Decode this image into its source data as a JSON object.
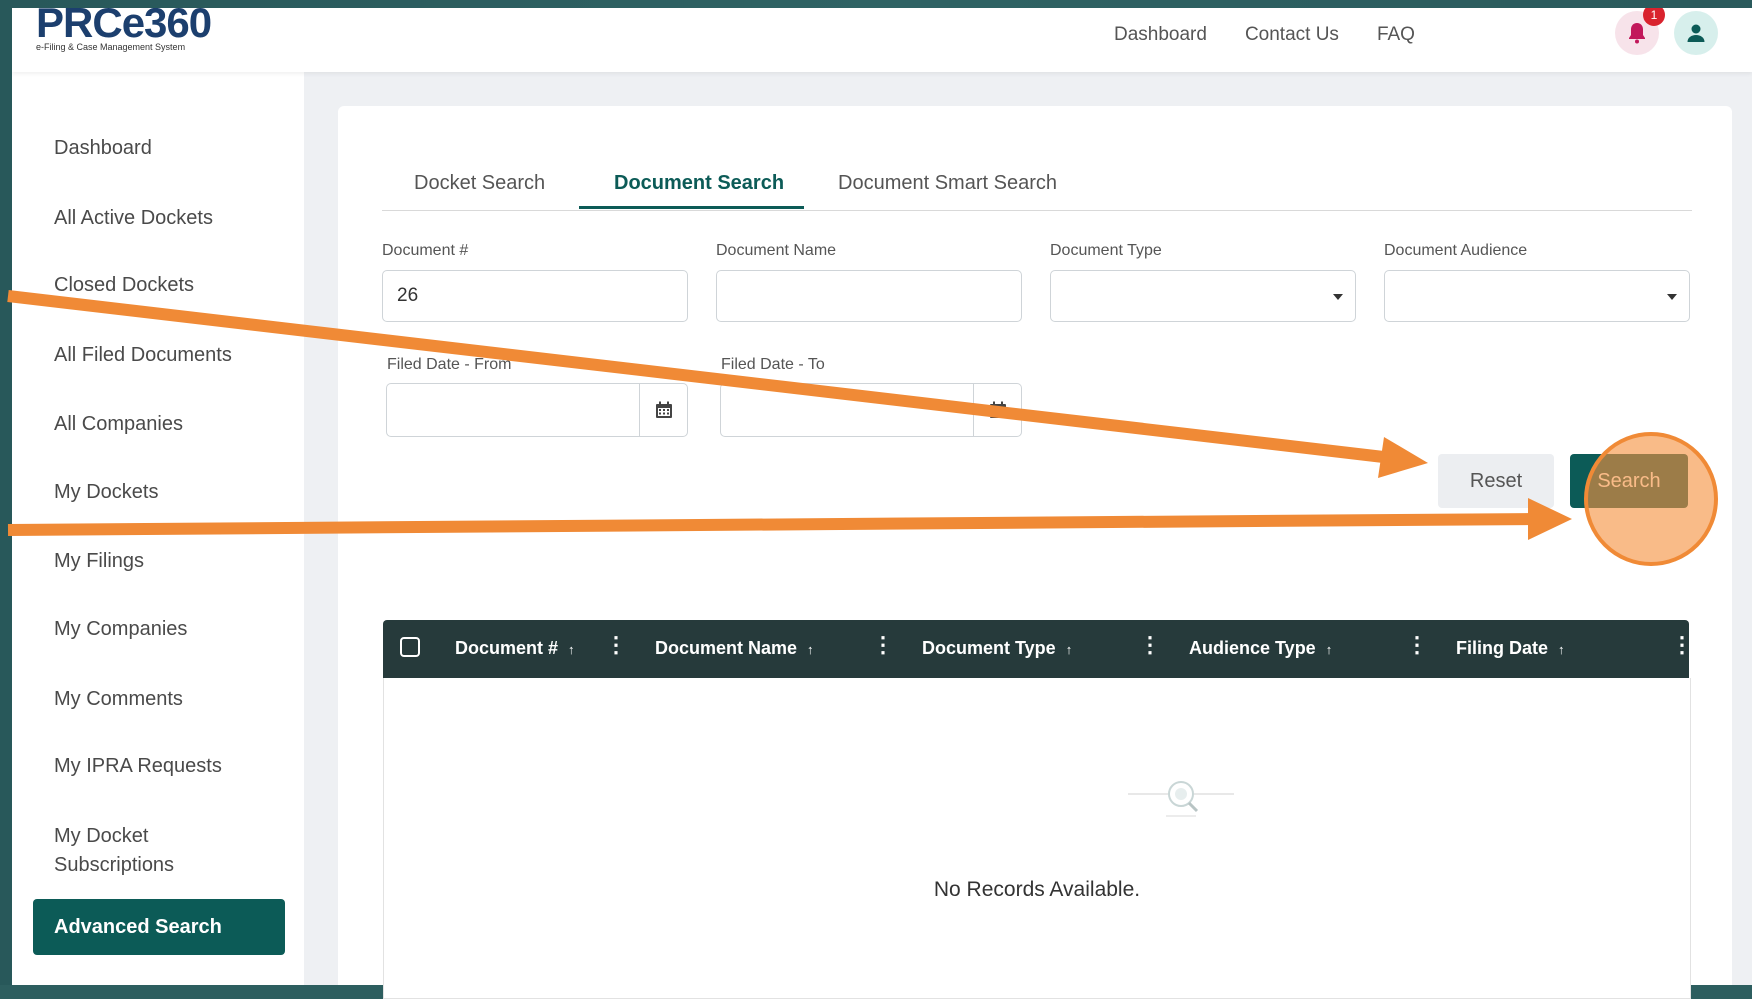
{
  "app": {
    "logo_text": "PRC",
    "logo_accent": "e360",
    "logo_tagline": "e-Filing & Case Management System"
  },
  "topnav": {
    "dashboard": "Dashboard",
    "contact": "Contact Us",
    "faq": "FAQ",
    "notification_count": "1"
  },
  "sidebar": {
    "items": [
      {
        "label": "Dashboard"
      },
      {
        "label": "All Active Dockets"
      },
      {
        "label": "Closed Dockets"
      },
      {
        "label": "All Filed Documents"
      },
      {
        "label": "All Companies"
      },
      {
        "label": "My Dockets"
      },
      {
        "label": "My Filings"
      },
      {
        "label": "My Companies"
      },
      {
        "label": "My Comments"
      },
      {
        "label": "My IPRA Requests"
      },
      {
        "label": "My Docket Subscriptions"
      },
      {
        "label": "Advanced Search"
      }
    ]
  },
  "tabs": {
    "docket": "Docket Search",
    "document": "Document Search",
    "smart": "Document Smart Search"
  },
  "form": {
    "doc_num_label": "Document #",
    "doc_num_value": "26",
    "doc_name_label": "Document Name",
    "doc_name_value": "",
    "doc_type_label": "Document Type",
    "doc_audience_label": "Document Audience",
    "filed_from_label": "Filed Date - From",
    "filed_to_label": "Filed Date - To"
  },
  "buttons": {
    "reset": "Reset",
    "search": "Search"
  },
  "table": {
    "columns": [
      "Document #",
      "Document Name",
      "Document Type",
      "Audience Type",
      "Filing Date"
    ],
    "empty_message": "No Records Available."
  },
  "colors": {
    "primary": "#0c5b57",
    "table_header": "#263a3b",
    "annotation": "#f08a36",
    "notification": "#d9232e"
  }
}
